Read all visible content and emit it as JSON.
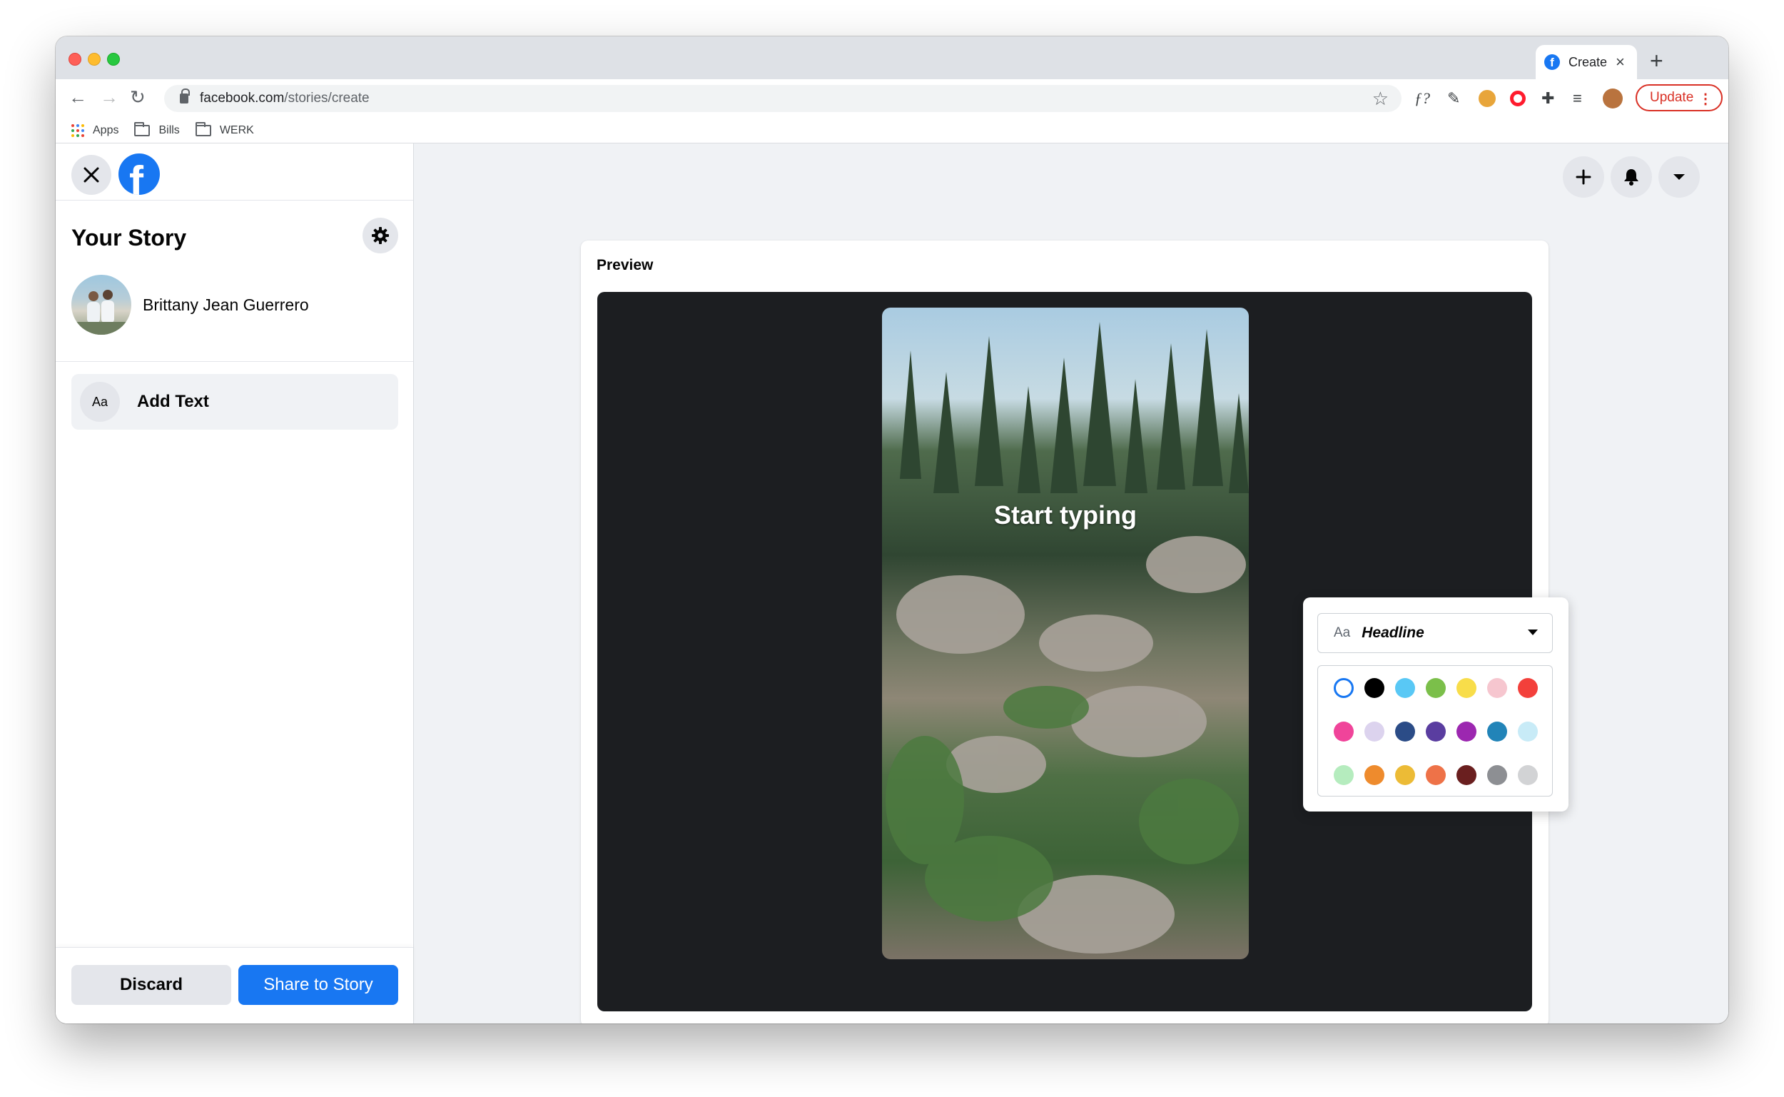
{
  "browser": {
    "tab_title": "Create",
    "url_host": "facebook.com",
    "url_path": "/stories/create",
    "update_label": "Update",
    "bookmarks": [
      {
        "label": "Apps",
        "icon": "apps-grid-icon"
      },
      {
        "label": "Bills",
        "icon": "folder-icon"
      },
      {
        "label": "WERK",
        "icon": "folder-icon"
      }
    ],
    "extensions": [
      "fx-extension-icon",
      "eyedropper-icon",
      "cookie-extension-icon",
      "opera-icon",
      "puzzle-icon",
      "media-queue-icon",
      "profile-avatar-icon"
    ]
  },
  "sidebar": {
    "title": "Your Story",
    "user_name": "Brittany Jean Guerrero",
    "add_text_icon": "Aa",
    "add_text_label": "Add Text",
    "discard_label": "Discard",
    "share_label": "Share to Story"
  },
  "header_icons": [
    "plus-icon",
    "notifications-icon",
    "account-menu-icon"
  ],
  "preview": {
    "label": "Preview",
    "placeholder_text": "Start typing"
  },
  "text_style": {
    "font_aa": "Aa",
    "font_name": "Headline",
    "colors": [
      [
        "#ffffff",
        "#000000",
        "#59c8f5",
        "#7bbf4a",
        "#f8dd4a",
        "#f6c6cf",
        "#f3403b"
      ],
      [
        "#f0449a",
        "#dcd3ee",
        "#2b4c87",
        "#5a3da0",
        "#9c27b0",
        "#2284b8",
        "#c8ebf7"
      ],
      [
        "#b5ecbe",
        "#ee8b2d",
        "#ecbb36",
        "#ee7248",
        "#6a1f1f",
        "#8d8f93",
        "#d2d3d5"
      ]
    ],
    "selected_color": "#ffffff",
    "accent": "#1877f2"
  }
}
